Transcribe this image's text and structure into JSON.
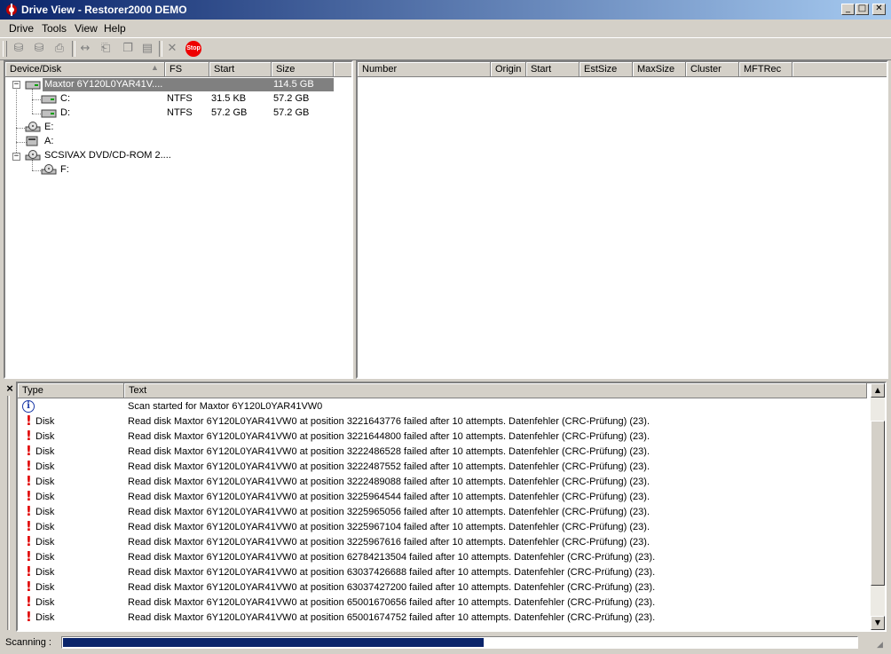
{
  "window": {
    "title": "Drive View - Restorer2000 DEMO",
    "min": "_",
    "max": "□",
    "close": "✕"
  },
  "menu": [
    {
      "label": "Drive"
    },
    {
      "label": "Tools"
    },
    {
      "label": "View"
    },
    {
      "label": "Help"
    }
  ],
  "toolbar": {
    "stop_label": "Stop"
  },
  "device_panel": {
    "columns": [
      "Device/Disk",
      "FS",
      "Start",
      "Size"
    ],
    "rows": [
      {
        "name": "Maxtor 6Y120L0YAR41V....",
        "fs": "",
        "start": "",
        "size": "114.5 GB"
      },
      {
        "name": "C:",
        "fs": "NTFS",
        "start": "31.5 KB",
        "size": "57.2 GB"
      },
      {
        "name": "D:",
        "fs": "NTFS",
        "start": "57.2 GB",
        "size": "57.2 GB"
      },
      {
        "name": "E:",
        "fs": "",
        "start": "",
        "size": ""
      },
      {
        "name": "A:",
        "fs": "",
        "start": "",
        "size": ""
      },
      {
        "name": "SCSIVAX DVD/CD-ROM 2....",
        "fs": "",
        "start": "",
        "size": ""
      },
      {
        "name": "F:",
        "fs": "",
        "start": "",
        "size": ""
      }
    ]
  },
  "result_panel": {
    "columns": [
      "Number",
      "Origin",
      "Start",
      "EstSize",
      "MaxSize",
      "Cluster",
      "MFTRec"
    ]
  },
  "log_panel": {
    "close": "×",
    "columns": [
      "Type",
      "Text"
    ],
    "rows": [
      {
        "type": "",
        "text": "Scan started for Maxtor 6Y120L0YAR41VW0"
      },
      {
        "type": "Disk",
        "text": "Read disk Maxtor 6Y120L0YAR41VW0 at position 3221643776 failed after 10 attempts. Datenfehler (CRC-Prüfung) (23)."
      },
      {
        "type": "Disk",
        "text": "Read disk Maxtor 6Y120L0YAR41VW0 at position 3221644800 failed after 10 attempts. Datenfehler (CRC-Prüfung) (23)."
      },
      {
        "type": "Disk",
        "text": "Read disk Maxtor 6Y120L0YAR41VW0 at position 3222486528 failed after 10 attempts. Datenfehler (CRC-Prüfung) (23)."
      },
      {
        "type": "Disk",
        "text": "Read disk Maxtor 6Y120L0YAR41VW0 at position 3222487552 failed after 10 attempts. Datenfehler (CRC-Prüfung) (23)."
      },
      {
        "type": "Disk",
        "text": "Read disk Maxtor 6Y120L0YAR41VW0 at position 3222489088 failed after 10 attempts. Datenfehler (CRC-Prüfung) (23)."
      },
      {
        "type": "Disk",
        "text": "Read disk Maxtor 6Y120L0YAR41VW0 at position 3225964544 failed after 10 attempts. Datenfehler (CRC-Prüfung) (23)."
      },
      {
        "type": "Disk",
        "text": "Read disk Maxtor 6Y120L0YAR41VW0 at position 3225965056 failed after 10 attempts. Datenfehler (CRC-Prüfung) (23)."
      },
      {
        "type": "Disk",
        "text": "Read disk Maxtor 6Y120L0YAR41VW0 at position 3225967104 failed after 10 attempts. Datenfehler (CRC-Prüfung) (23)."
      },
      {
        "type": "Disk",
        "text": "Read disk Maxtor 6Y120L0YAR41VW0 at position 3225967616 failed after 10 attempts. Datenfehler (CRC-Prüfung) (23)."
      },
      {
        "type": "Disk",
        "text": "Read disk Maxtor 6Y120L0YAR41VW0 at position 62784213504 failed after 10 attempts. Datenfehler (CRC-Prüfung) (23)."
      },
      {
        "type": "Disk",
        "text": "Read disk Maxtor 6Y120L0YAR41VW0 at position 63037426688 failed after 10 attempts. Datenfehler (CRC-Prüfung) (23)."
      },
      {
        "type": "Disk",
        "text": "Read disk Maxtor 6Y120L0YAR41VW0 at position 63037427200 failed after 10 attempts. Datenfehler (CRC-Prüfung) (23)."
      },
      {
        "type": "Disk",
        "text": "Read disk Maxtor 6Y120L0YAR41VW0 at position 65001670656 failed after 10 attempts. Datenfehler (CRC-Prüfung) (23)."
      },
      {
        "type": "Disk",
        "text": "Read disk Maxtor 6Y120L0YAR41VW0 at position 65001674752 failed after 10 attempts. Datenfehler (CRC-Prüfung) (23)."
      }
    ]
  },
  "status": {
    "label": "Scanning :",
    "progress": 0.53
  }
}
